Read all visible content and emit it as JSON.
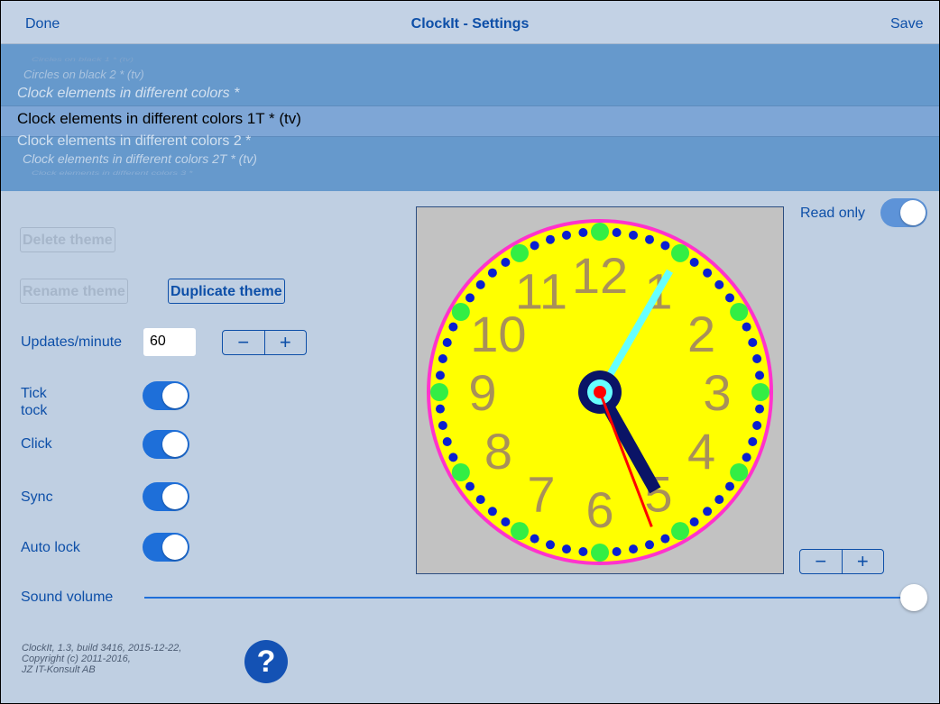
{
  "nav": {
    "done": "Done",
    "title": "ClockIt - Settings",
    "save": "Save"
  },
  "picker": {
    "rows": [
      "Circles on black 1 * (tv)",
      "Circles on black 2 * (tv)",
      "Clock elements in different colors *",
      "Clock elements in different colors 1T * (tv)",
      "Clock elements in different colors 2 *",
      "Clock elements in different colors 2T * (tv)",
      "Clock elements in different colors 3 *"
    ],
    "selected_index": 3
  },
  "buttons": {
    "delete_theme": "Delete theme",
    "rename_theme": "Rename theme",
    "duplicate_theme": "Duplicate theme"
  },
  "updates": {
    "label": "Updates/minute",
    "value": "60"
  },
  "stepper": {
    "minus": "−",
    "plus": "+"
  },
  "toggles": {
    "tick_tock_line1": "Tick",
    "tick_tock_line2": "tock",
    "click": "Click",
    "sync": "Sync",
    "auto_lock": "Auto lock",
    "read_only": "Read only"
  },
  "sound": {
    "label": "Sound volume",
    "level": 1.0
  },
  "clock": {
    "numerals": [
      "12",
      "1",
      "2",
      "3",
      "4",
      "5",
      "6",
      "7",
      "8",
      "9",
      "10",
      "11"
    ],
    "hour_value": 5.02,
    "minute_value": 5.0,
    "second_value": 26.5,
    "colors": {
      "face": "#ffff00",
      "rim": "#ff33cc",
      "numerals": "#a8905a",
      "dots": "#0a1fd0",
      "hour_dots": "#33ee44",
      "minute_hand": "#66ffff",
      "hour_hand": "#0a1466",
      "second_hand": "#ff0000",
      "background": "#c2c2c2"
    }
  },
  "footer": {
    "line1": "ClockIt, 1.3, build 3416, 2015-12-22,",
    "line2": "Copyright (c) 2011-2016,",
    "line3": "JZ IT-Konsult AB",
    "help_icon_glyph": "?"
  },
  "colors": {
    "accent": "#0d4fa8",
    "toggle_on": "#1e6fd9",
    "background": "#bfcfe2",
    "picker_bg": "#6699cc"
  }
}
